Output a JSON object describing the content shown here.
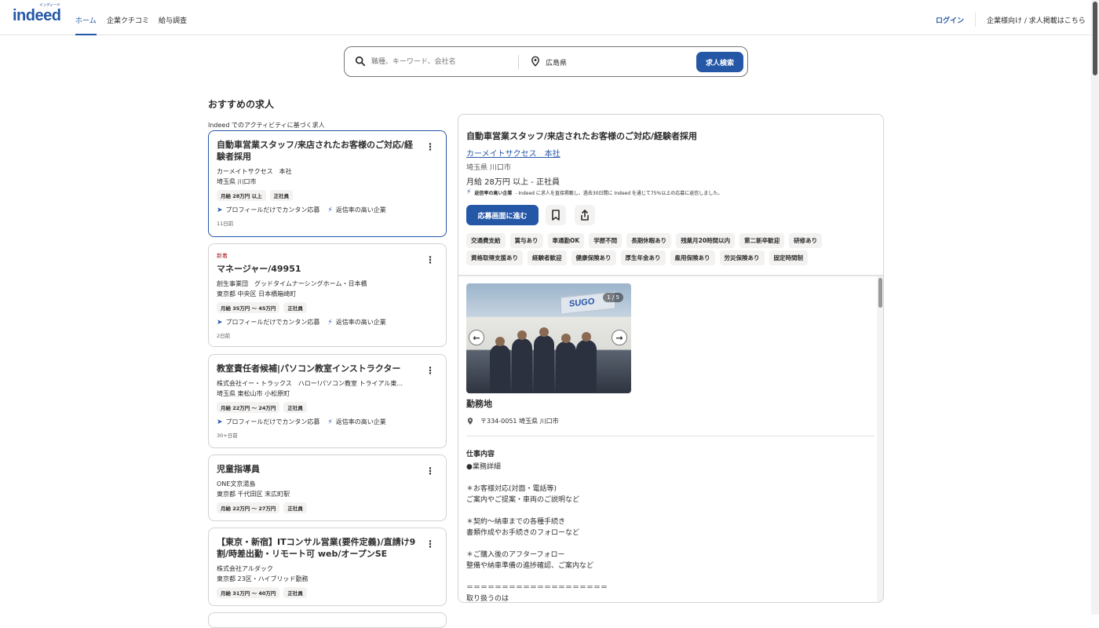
{
  "header": {
    "logo": "indeed",
    "logo_ruby": "インディード",
    "tabs": [
      "ホーム",
      "企業クチコミ",
      "給与調査"
    ],
    "login": "ログイン",
    "employer": "企業様向け / 求人掲載はこちら"
  },
  "search": {
    "what_placeholder": "職種、キーワード、会社名",
    "where_value": "広島県",
    "button": "求人検索"
  },
  "section": {
    "title": "おすすめの求人",
    "subtitle": "Indeed でのアクティビティに基づく求人"
  },
  "jobs": [
    {
      "title": "自動車営業スタッフ/来店されたお客様のご対応/経験者採用",
      "company": "カーメイトサクセス　本社",
      "location": "埼玉県 川口市",
      "salary": "月給 28万円 以上",
      "type": "正社員",
      "feature1": "プロフィールだけでカンタン応募",
      "feature2": "返信率の高い企業",
      "date": "11日前"
    },
    {
      "new_tag": "新着",
      "title": "マネージャー/49951",
      "company": "創生事業団　グッドタイムナーシングホーム・日本橋",
      "location": "東京都 中央区 日本橋箱崎町",
      "salary": "月給 35万円 ～ 45万円",
      "type": "正社員",
      "feature1": "プロフィールだけでカンタン応募",
      "feature2": "返信率の高い企業",
      "date": "2日前"
    },
    {
      "title": "教室責任者候補|パソコン教室インストラクター",
      "company": "株式会社イー・トラックス　ハロー!パソコン教室 トライアル東...",
      "location": "埼玉県 東松山市 小松原町",
      "salary": "月給 22万円 ～ 24万円",
      "type": "正社員",
      "feature1": "プロフィールだけでカンタン応募",
      "feature2": "返信率の高い企業",
      "date": "30+日前"
    },
    {
      "title": "児童指導員",
      "company": "ONE文京湯島",
      "location": "東京都 千代田区 末広町駅",
      "salary": "月給 22万円 ～ 27万円",
      "type": "正社員"
    },
    {
      "title": "【東京・新宿】ITコンサル営業(要件定義)/直請け9割/時差出勤・リモート可 web/オープンSE",
      "company": "株式会社アルダック",
      "location": "東京都 23区・ハイブリッド勤務",
      "salary": "月給 31万円 ～ 40万円",
      "type": "正社員"
    }
  ],
  "detail": {
    "title": "自動車営業スタッフ/来店されたお客様のご対応/経験者採用",
    "company": "カーメイトサクセス　本社",
    "location": "埼玉県 川口市",
    "salary": "月給 28万円 以上 - 正社員",
    "note_bold": "返信率の高い企業",
    "note_text": "- Indeed に求人を直接掲載し、過去30日間に Indeed を通じて75%以上の応募に返信しました。",
    "apply": "応募画面に進む",
    "tags_row1": [
      "交通費支給",
      "賞与あり",
      "車通勤OK",
      "学歴不問",
      "長期休暇あり",
      "残業月20時間以内",
      "第二新卒歓迎",
      "研修あり"
    ],
    "tags_row2": [
      "資格取得支援あり",
      "経験者歓迎",
      "健康保険あり",
      "厚生年金あり",
      "雇用保険あり",
      "労災保険あり",
      "固定時間制"
    ],
    "photo_counter": "1 / 5",
    "photo_sign": "SUGO",
    "work_title": "勤務地",
    "work_address": "〒334-0051 埼玉県 川口市",
    "job_heading": "仕事内容",
    "job_lines": [
      "●業務詳細",
      "",
      "＊お客様対応(対面・電話等)",
      "ご案内やご提案・車両のご説明など",
      "",
      "＊契約～納車までの各種手続き",
      "書類作成やお手続きのフォローなど",
      "",
      "＊ご購入後のアフターフォロー",
      "整備や納車準備の進捗確認、ご案内など",
      "",
      "＝＝＝＝＝＝＝＝＝＝＝＝＝＝＝＝＝＝＝＝",
      "取り扱うのは"
    ]
  },
  "colors": {
    "brand": "#2557a7",
    "text": "#2d2d2d",
    "pill_bg": "#f3f2f1"
  },
  "icons": [
    "search-icon",
    "location-pin-icon",
    "kebab-menu-icon",
    "send-arrow-icon",
    "lightning-icon",
    "bookmark-icon",
    "share-icon",
    "chevron-left-icon",
    "chevron-right-icon"
  ]
}
